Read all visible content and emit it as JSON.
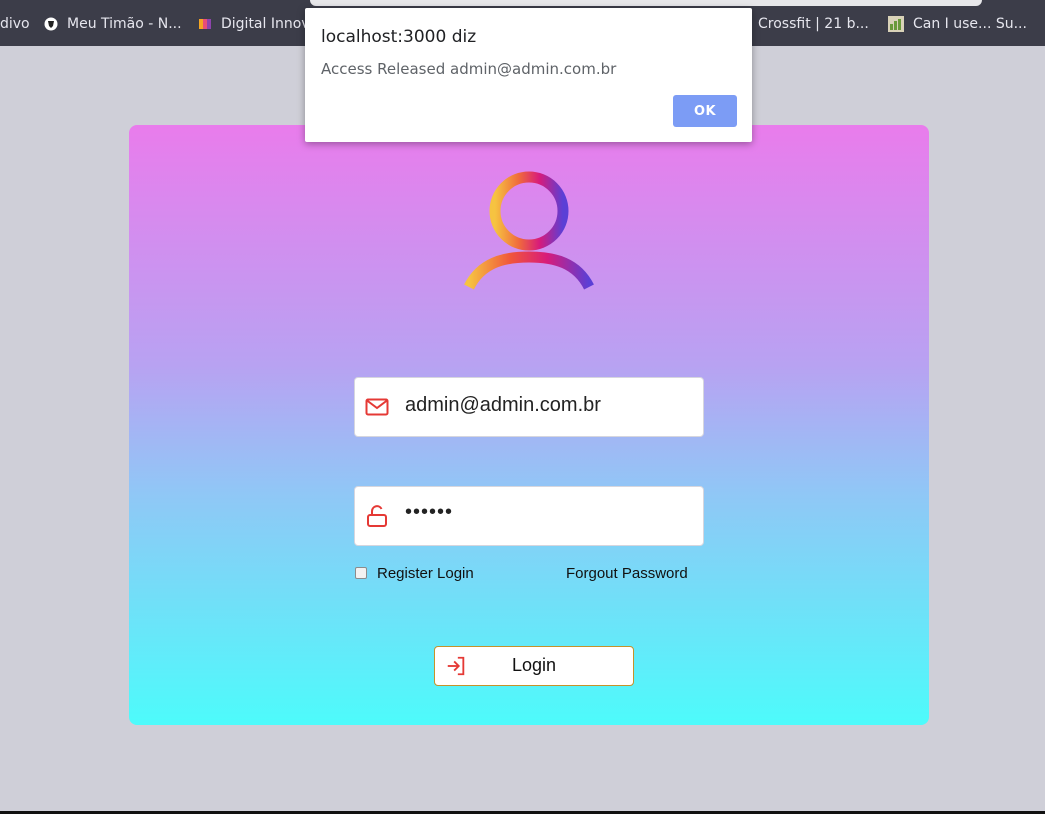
{
  "bookmarks": [
    {
      "label": "divo",
      "icon": "none"
    },
    {
      "label": "Meu Timão - N...",
      "icon": "team-crest-icon"
    },
    {
      "label": "Digital Innov",
      "icon": "dio-icon"
    },
    {
      "label": "Crossfit | 21 b...",
      "icon": "none"
    },
    {
      "label": "Can I use... Su...",
      "icon": "caniuse-icon"
    }
  ],
  "dialog": {
    "title": "localhost:3000 diz",
    "message": "Access Released admin@admin.com.br",
    "ok_label": "OK"
  },
  "login_form": {
    "email_value": "admin@admin.com.br",
    "password_value": "••••••",
    "remember_label": "Register Login",
    "remember_checked": false,
    "forgot_label": "Forgout Password",
    "submit_label": "Login"
  },
  "colors": {
    "accent_red": "#e53935",
    "card_gradient_top": "#e97cec",
    "card_gradient_bottom": "#4dfbfb",
    "dialog_button": "#7c9cf5"
  }
}
